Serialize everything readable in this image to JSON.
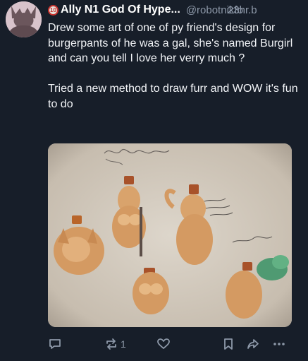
{
  "post": {
    "author": {
      "display_name": "Ally N1 God Of Hype...",
      "handle": "@robotnikfo",
      "badge_icon": "numbered-badge-icon",
      "badge_text": "10"
    },
    "timestamp": "23hr.b",
    "text": {
      "paragraph_1": "Drew some art of one of py friend's design for burgerpants of he was a gal, she's named Burgirl and can you tell I love her verry much ?",
      "paragraph_2": "Tried a new method to draw furr and WOW it's fun to do"
    },
    "attachment": {
      "type": "image",
      "description_icon": "sketch-artwork-image"
    },
    "actions": {
      "reply_icon": "reply-icon",
      "repost_icon": "repost-icon",
      "repost_count": "1",
      "like_icon": "heart-icon",
      "bookmark_icon": "bookmark-icon",
      "share_icon": "share-icon",
      "more_icon": "more-icon"
    }
  },
  "colors": {
    "background": "#171e29",
    "text": "#f2f4f7",
    "muted": "#8d98a8",
    "avatar": "#d8c3cb",
    "badge_ring": "#c8322e"
  }
}
